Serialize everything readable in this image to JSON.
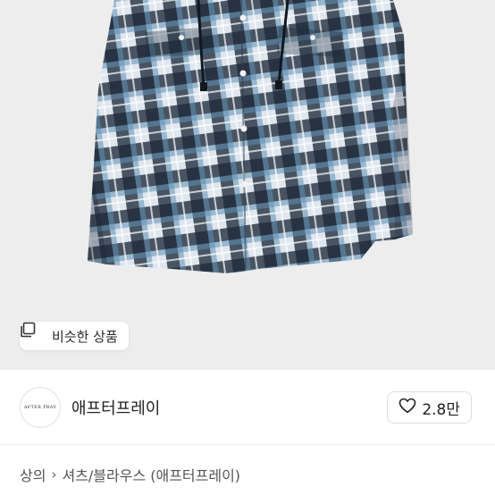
{
  "product": {
    "image_icon": "checked-shirt-photo",
    "similar_button": {
      "label": "비슷한 상품",
      "icon": "copy-stack-icon"
    }
  },
  "shop": {
    "name": "애프터프레이",
    "logo_text": "AFTER PRAY",
    "like_count": "2.8만",
    "like_icon": "heart-outline-icon"
  },
  "breadcrumb": {
    "items": [
      "상의",
      "셔츠/블라우스 (애프터프레이)"
    ],
    "separator_icon": "chevron-right-icon"
  }
}
